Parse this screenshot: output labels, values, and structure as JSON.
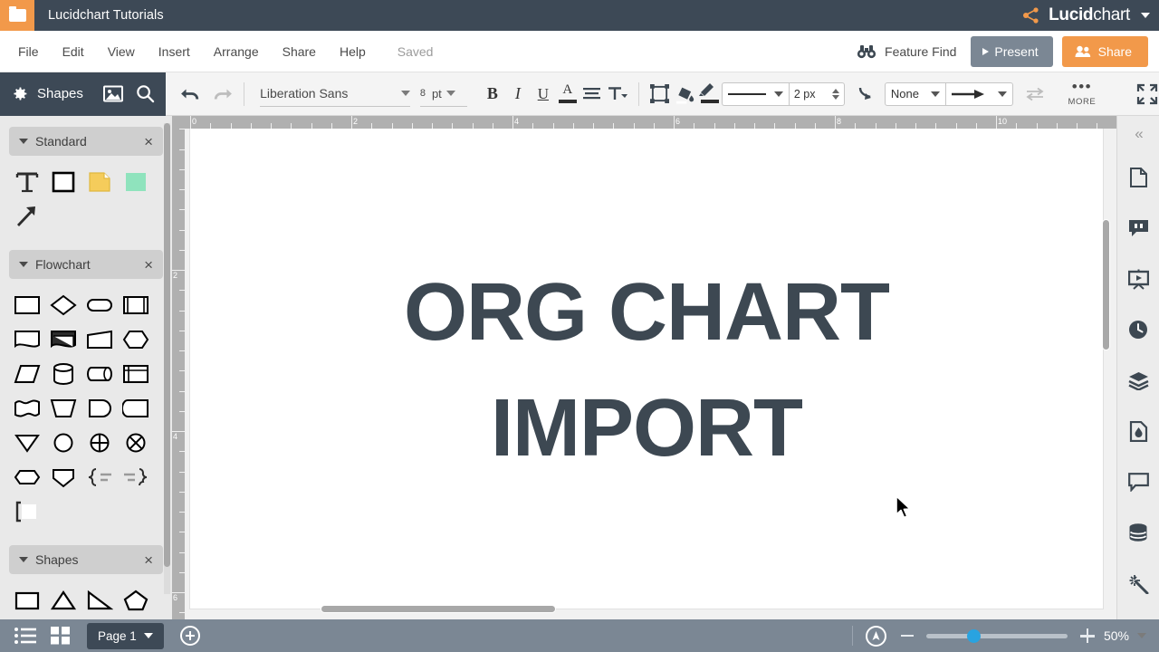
{
  "titlebar": {
    "folder_icon": "folder-icon",
    "document_title": "Lucidchart Tutorials",
    "brand_bold": "Lucid",
    "brand_light": "chart",
    "brand_caret": "chevron-down-icon"
  },
  "menubar": {
    "items": [
      {
        "label": "File"
      },
      {
        "label": "Edit"
      },
      {
        "label": "View"
      },
      {
        "label": "Insert"
      },
      {
        "label": "Arrange"
      },
      {
        "label": "Share"
      },
      {
        "label": "Help"
      }
    ],
    "save_status": "Saved",
    "feature_find": "Feature Find",
    "present_button": "Present",
    "share_button": "Share"
  },
  "toolbar": {
    "panel_title": "Shapes",
    "undo_icon": "undo-icon",
    "redo_icon": "redo-icon",
    "font_family": "Liberation Sans",
    "font_size": "8",
    "font_size_unit": "pt",
    "bold": "B",
    "italic": "I",
    "underline": "U",
    "font_color": "A",
    "align_icon": "text-align-icon",
    "text_options_icon": "text-options-icon",
    "shape_border_icon": "shape-border-icon",
    "fill_icon": "fill-bucket-icon",
    "line_color_icon": "line-color-icon",
    "line_style": "solid",
    "line_width": "2 px",
    "line_jump_icon": "line-jump-icon",
    "endpoint_start": "None",
    "endpoint_end": "arrow",
    "swap_endpoints_icon": "swap-arrows-icon",
    "more_label": "MORE",
    "fullscreen_icon": "fullscreen-icon"
  },
  "left_panel": {
    "header_icons": [
      "gear-icon",
      "image-icon",
      "search-icon"
    ],
    "groups": [
      {
        "title": "Standard",
        "shapes": [
          "text",
          "rectangle",
          "sticky-note",
          "green-square",
          "arrow-line"
        ]
      },
      {
        "title": "Flowchart",
        "shapes": [
          "process",
          "decision",
          "terminator",
          "predefined-process",
          "document",
          "multi-document",
          "manual-input",
          "preparation",
          "data",
          "database",
          "direct-data",
          "internal-storage",
          "paper-tape",
          "manual-operation",
          "delay",
          "stored-data",
          "merge",
          "connector",
          "or",
          "summing-junction",
          "extract",
          "sort",
          "annotation-right",
          "annotation-left",
          "bracket-note"
        ]
      },
      {
        "title": "Shapes",
        "shapes": [
          "rectangle",
          "triangle",
          "right-triangle",
          "pentagon"
        ]
      }
    ],
    "close_glyph": "×"
  },
  "canvas": {
    "ruler_h_labels": [
      "0",
      "2",
      "4",
      "6",
      "8",
      "10"
    ],
    "ruler_v_labels": [
      "2",
      "4",
      "6"
    ],
    "text_lines": [
      "ORG CHART",
      "IMPORT"
    ],
    "text_color": "#3d4852"
  },
  "right_rail": {
    "collapse_glyph": "«",
    "items": [
      "page-icon",
      "comment-quote-icon",
      "presentation-icon",
      "history-clock-icon",
      "layers-icon",
      "theme-ink-icon",
      "comment-bubble-icon",
      "data-database-icon",
      "magic-wand-icon"
    ]
  },
  "bottombar": {
    "list_view_icon": "list-view-icon",
    "grid_view_icon": "grid-view-icon",
    "page_name": "Page 1",
    "add_page_icon": "plus-circle-icon",
    "navigate_icon": "navigate-pointer-icon",
    "zoom_out_icon": "minus-icon",
    "zoom_in_icon": "plus-icon",
    "zoom_level": "50%",
    "zoom_caret": "chevron-down-icon"
  },
  "colors": {
    "brand_orange": "#f2994a",
    "dark_slate": "#3d4956",
    "bottom_gray": "#7b8794",
    "accent_blue": "#29a3e0"
  }
}
